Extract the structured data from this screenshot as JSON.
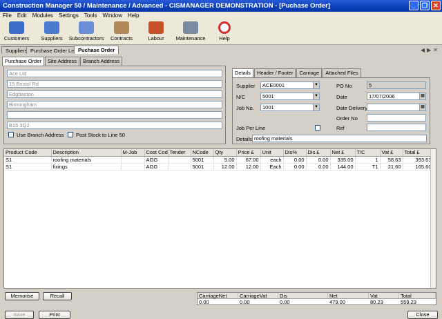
{
  "window": {
    "title": "Construction Manager 50 / Maintenance / Advanced  -  CISMANAGER  DEMONSTRATION  - [Puchase Order]"
  },
  "menu": [
    "File",
    "Edit",
    "Modules",
    "Settings",
    "Tools",
    "Window",
    "Help"
  ],
  "toolbar": [
    {
      "label": "Customers",
      "icon": "customers-icon",
      "color": "#3a6cc8"
    },
    {
      "label": "Suppliers",
      "icon": "suppliers-icon",
      "color": "#4b7bd0"
    },
    {
      "label": "Subcontractors",
      "icon": "subcontractors-icon",
      "color": "#6a8ed8"
    },
    {
      "label": "Contracts",
      "icon": "contracts-icon",
      "color": "#b0895a"
    },
    {
      "label": "Labour",
      "icon": "labour-icon",
      "color": "#c8502a"
    },
    {
      "label": "Maintenance",
      "icon": "maintenance-icon",
      "color": "#7a8aa0"
    },
    {
      "label": "Help",
      "icon": "help-icon",
      "color": "#d03030"
    }
  ],
  "top_tabs": [
    "Suppliers",
    "Purchase Order List",
    "Puchase Order"
  ],
  "left_tabs": [
    "Purchase Order",
    "Site Address",
    "Branch Address"
  ],
  "address": [
    "Ace Ltd",
    "15 Bristol Rd",
    "Edgbaston",
    "Birmingham",
    "",
    "B15 3QJ"
  ],
  "checkboxes": {
    "use_branch": "Use Branch Address",
    "post_stock": "Post Stock to Line 50"
  },
  "right_tabs": [
    "Details",
    "Header / Footer",
    "Carriage",
    "Attached Files"
  ],
  "details": {
    "supplier_label": "Supplier",
    "supplier": "ACE0001",
    "nc_label": "N/C",
    "nc": "5001",
    "job_label": "Job No.",
    "job": "1001",
    "po_label": "PO No",
    "po": "5",
    "date_label": "Date",
    "date": "17/07/2006",
    "delivery_label": "Date Delivery",
    "delivery": "",
    "order_label": "Order No",
    "order": "",
    "ref_label": "Ref",
    "ref": "",
    "job_per_line_label": "Job Per Line",
    "details_label": "Details",
    "details": "roofing materials"
  },
  "grid": {
    "headers": [
      "Product Code",
      "Description",
      "M-Job",
      "Cost Code",
      "Tender",
      "NCode",
      "Qty",
      "Price £",
      "Unit",
      "Dis%",
      "Dis £",
      "Net £",
      "T/C",
      "Vat £",
      "Total £"
    ],
    "rows": [
      [
        "S1",
        "roofing materials",
        "",
        "AGG",
        "",
        "5001",
        "5.00",
        "67.00",
        "each",
        "0.00",
        "0.00",
        "335.00",
        "1",
        "58.63",
        "393.63"
      ],
      [
        "S1",
        "fixings",
        "",
        "AGG",
        "",
        "5001",
        "12.00",
        "12.00",
        "Each",
        "0.00",
        "0.00",
        "144.00",
        "T1",
        "21.60",
        "165.60"
      ]
    ]
  },
  "buttons": {
    "memorise": "Memorise",
    "recall": "Recall",
    "save": "Save",
    "print": "Print",
    "close": "Close"
  },
  "totals": {
    "headers": [
      "CarriageNet",
      "CarriageVat",
      "Dis",
      "Net",
      "Vat",
      "Total"
    ],
    "values": [
      "0.00",
      "0.00",
      "0.00",
      "479.00",
      "80.23",
      "559.23"
    ]
  }
}
